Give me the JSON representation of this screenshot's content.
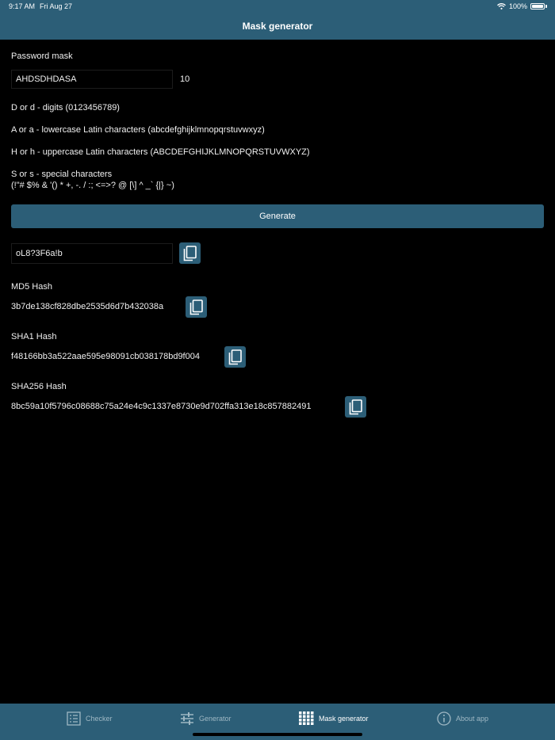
{
  "status_bar": {
    "time": "9:17 AM",
    "date": "Fri Aug 27",
    "battery": "100%"
  },
  "nav": {
    "title": "Mask generator"
  },
  "mask": {
    "label": "Password mask",
    "value": "AHDSDHDASA",
    "length": "10"
  },
  "legend": {
    "digits": "D or d - digits (0123456789)",
    "lowercase": "A or a - lowercase Latin characters (abcdefghijklmnopqrstuvwxyz)",
    "uppercase": "H or h - uppercase Latin characters (ABCDEFGHIJKLMNOPQRSTUVWXYZ)",
    "special_title": "S or s - special characters",
    "special_chars": "(!\"# $% & '() * +, -. / :; <=>? @ [\\] ^ _` {|} ~)"
  },
  "generate": {
    "label": "Generate"
  },
  "result": {
    "password": "oL8?3F6a!b"
  },
  "hashes": {
    "md5": {
      "label": "MD5 Hash",
      "value": "3b7de138cf828dbe2535d6d7b432038a"
    },
    "sha1": {
      "label": "SHA1 Hash",
      "value": "f48166bb3a522aae595e98091cb038178bd9f004"
    },
    "sha256": {
      "label": "SHA256 Hash",
      "value": "8bc59a10f5796c08688c75a24e4c9c1337e8730e9d702ffa313e18c857882491"
    }
  },
  "tabs": [
    {
      "label": "Checker",
      "icon": "checklist-icon",
      "active": false
    },
    {
      "label": "Generator",
      "icon": "sliders-icon",
      "active": false
    },
    {
      "label": "Mask generator",
      "icon": "grid-icon",
      "active": true
    },
    {
      "label": "About app",
      "icon": "info-icon",
      "active": false
    }
  ],
  "colors": {
    "accent": "#2c5e77",
    "background": "#000000",
    "text": "#f0f0f0"
  }
}
